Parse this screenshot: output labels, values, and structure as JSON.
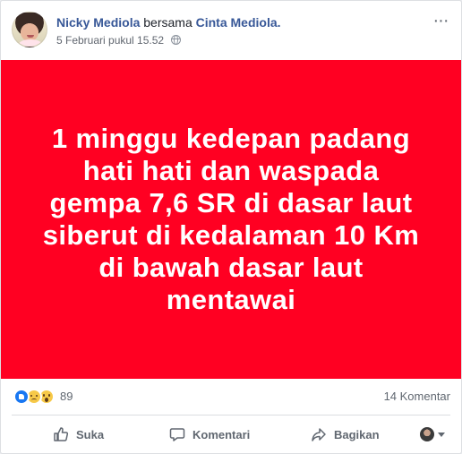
{
  "post": {
    "author": "Nicky Mediola",
    "with_text": "bersama",
    "tagged": "Cinta Mediola.",
    "timestamp": "5 Februari pukul 15.52",
    "audience_icon": "globe-icon",
    "more_icon": "more-options-icon"
  },
  "poster": {
    "background_color": "#ff0022",
    "text": "1 minggu kedepan padang hati hati dan waspada gempa 7,6 SR di dasar laut siberut di kedalaman 10 Km di bawah dasar laut mentawai"
  },
  "reactions": {
    "icons": [
      "like-icon",
      "sad-icon",
      "wow-icon"
    ],
    "count": "89",
    "comments": "14 Komentar"
  },
  "actions": {
    "like_label": "Suka",
    "comment_label": "Komentari",
    "share_label": "Bagikan"
  }
}
